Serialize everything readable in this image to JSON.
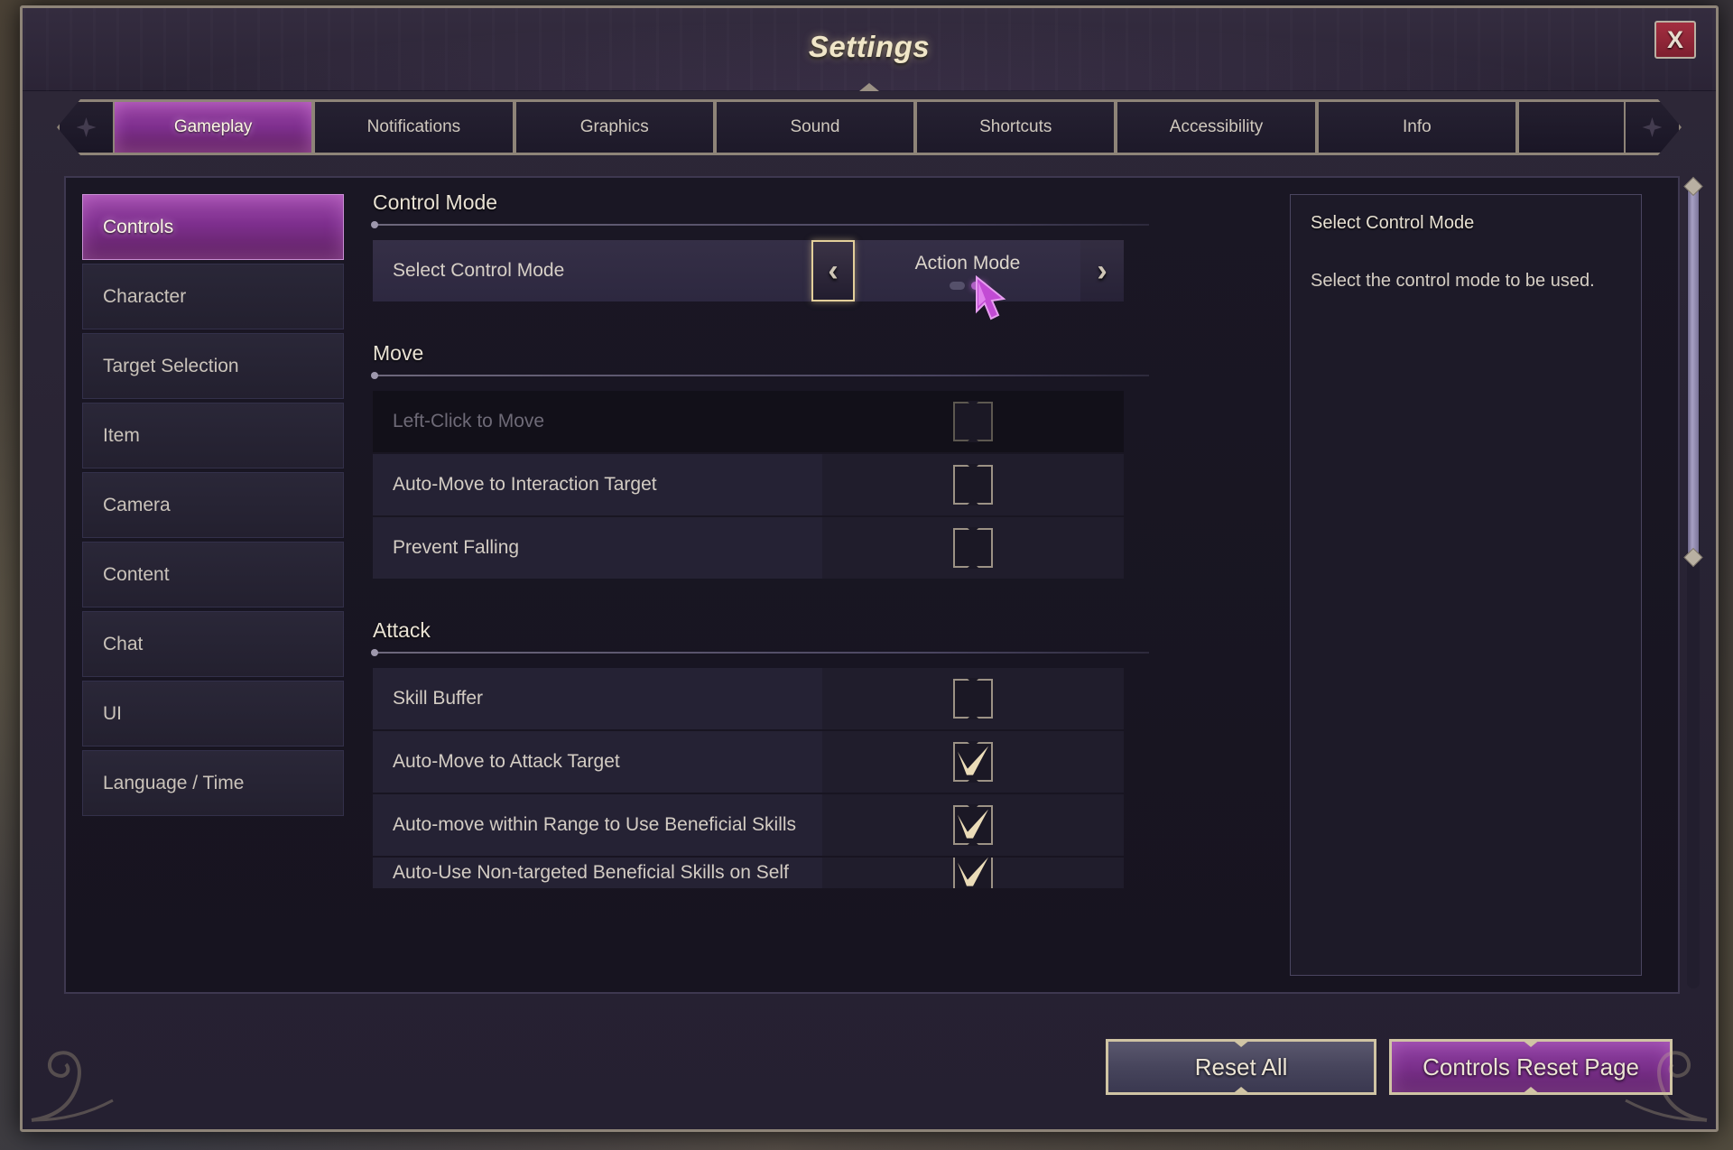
{
  "window": {
    "title": "Settings",
    "close_label": "X"
  },
  "tabs": [
    {
      "label": "Gameplay",
      "active": true
    },
    {
      "label": "Notifications",
      "active": false
    },
    {
      "label": "Graphics",
      "active": false
    },
    {
      "label": "Sound",
      "active": false
    },
    {
      "label": "Shortcuts",
      "active": false
    },
    {
      "label": "Accessibility",
      "active": false
    },
    {
      "label": "Info",
      "active": false
    }
  ],
  "sidebar": {
    "items": [
      {
        "label": "Controls",
        "active": true
      },
      {
        "label": "Character",
        "active": false
      },
      {
        "label": "Target Selection",
        "active": false
      },
      {
        "label": "Item",
        "active": false
      },
      {
        "label": "Camera",
        "active": false
      },
      {
        "label": "Content",
        "active": false
      },
      {
        "label": "Chat",
        "active": false
      },
      {
        "label": "UI",
        "active": false
      },
      {
        "label": "Language / Time",
        "active": false
      }
    ]
  },
  "sections": {
    "control_mode": {
      "title": "Control Mode",
      "selector": {
        "label": "Select Control Mode",
        "value": "Action Mode",
        "prev_arrow": "‹",
        "next_arrow": "›",
        "page_count": 2,
        "active_page": 2
      }
    },
    "move": {
      "title": "Move",
      "rows": [
        {
          "label": "Left-Click to Move",
          "checked": false,
          "disabled": true
        },
        {
          "label": "Auto-Move to Interaction Target",
          "checked": false,
          "disabled": false
        },
        {
          "label": "Prevent Falling",
          "checked": false,
          "disabled": false
        }
      ]
    },
    "attack": {
      "title": "Attack",
      "rows": [
        {
          "label": "Skill Buffer",
          "checked": false,
          "disabled": false
        },
        {
          "label": "Auto-Move to Attack Target",
          "checked": true,
          "disabled": false
        },
        {
          "label": "Auto-move within Range to Use Beneficial Skills",
          "checked": true,
          "disabled": false
        },
        {
          "label": "Auto-Use Non-targeted Beneficial Skills on Self",
          "checked": true,
          "disabled": false
        }
      ]
    }
  },
  "info_panel": {
    "title": "Select Control Mode",
    "body": "Select the control mode to be used."
  },
  "footer": {
    "reset_all_label": "Reset All",
    "reset_page_label": "Controls Reset Page"
  },
  "colors": {
    "accent_purple": "#7e2f8e",
    "gold_border": "#d0c4a4",
    "close_red": "#a32e40",
    "panel_dark": "#1a1724"
  }
}
